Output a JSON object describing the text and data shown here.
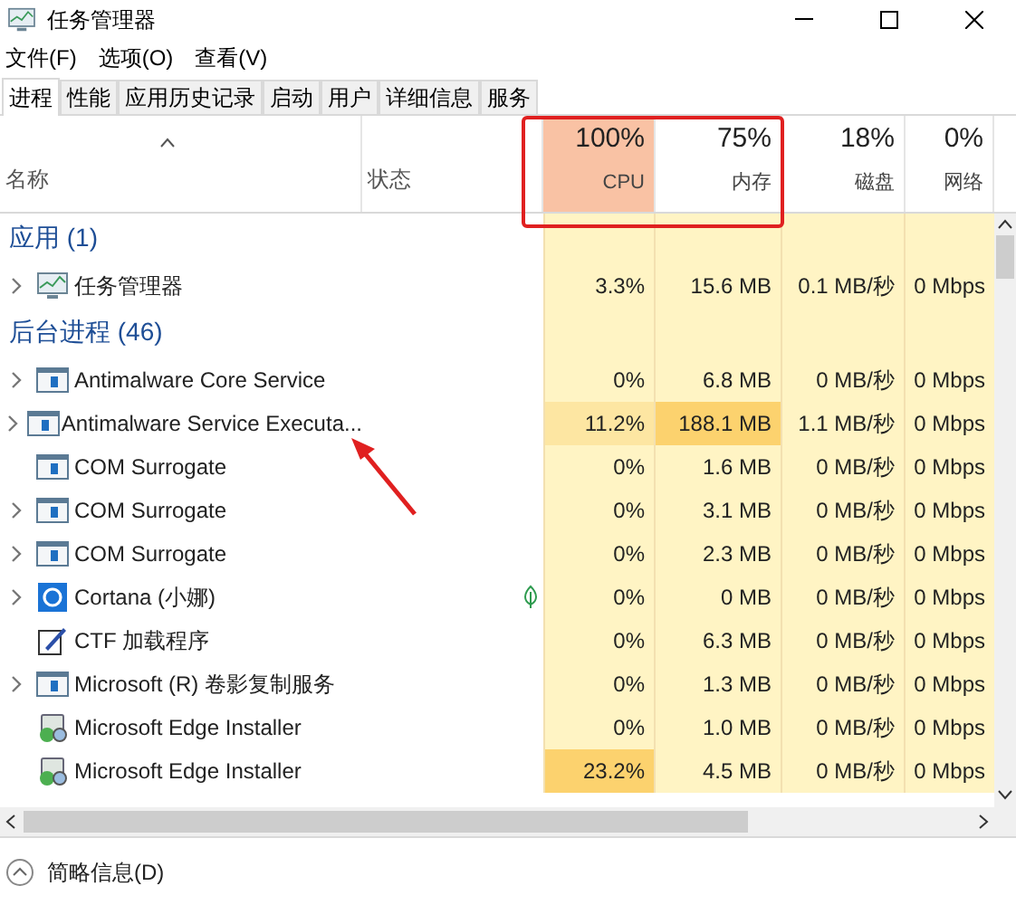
{
  "window": {
    "title": "任务管理器"
  },
  "menu": [
    "文件(F)",
    "选项(O)",
    "查看(V)"
  ],
  "tabs": [
    {
      "label": "进程",
      "selected": true
    },
    {
      "label": "性能",
      "selected": false
    },
    {
      "label": "应用历史记录",
      "selected": false
    },
    {
      "label": "启动",
      "selected": false
    },
    {
      "label": "用户",
      "selected": false
    },
    {
      "label": "详细信息",
      "selected": false
    },
    {
      "label": "服务",
      "selected": false
    }
  ],
  "columns": [
    {
      "kind": "name",
      "label": "名称"
    },
    {
      "kind": "status",
      "label": "状态"
    },
    {
      "kind": "metric",
      "value": "100%",
      "label": "CPU",
      "color": "#f9c2a4"
    },
    {
      "kind": "metric",
      "value": "75%",
      "label": "内存",
      "color": "#ffffff"
    },
    {
      "kind": "metric",
      "value": "18%",
      "label": "磁盘",
      "color": "#ffffff"
    },
    {
      "kind": "metric",
      "value": "0%",
      "label": "网络",
      "color": "#ffffff"
    }
  ],
  "rows": [
    {
      "kind": "group",
      "label": "应用 (1)"
    },
    {
      "kind": "taskmgr",
      "expandable": true,
      "suspended": false,
      "name": "任务管理器",
      "cells": [
        {
          "text": "3.3%"
        },
        {
          "text": "15.6 MB"
        },
        {
          "text": "0.1 MB/秒"
        },
        {
          "text": "0 Mbps"
        }
      ]
    },
    {
      "kind": "group",
      "label": "后台进程 (46)"
    },
    {
      "kind": "service",
      "expandable": true,
      "suspended": false,
      "name": "Antimalware Core Service",
      "cells": [
        {
          "text": "0%"
        },
        {
          "text": "6.8 MB"
        },
        {
          "text": "0 MB/秒"
        },
        {
          "text": "0 Mbps"
        }
      ]
    },
    {
      "kind": "service",
      "expandable": true,
      "suspended": false,
      "name": "Antimalware Service Executa...",
      "cells": [
        {
          "text": "11.2%",
          "color": "#fde6a2"
        },
        {
          "text": "188.1 MB",
          "color": "#fcd26e"
        },
        {
          "text": "1.1 MB/秒"
        },
        {
          "text": "0 Mbps"
        }
      ]
    },
    {
      "kind": "service",
      "expandable": false,
      "suspended": false,
      "name": "COM Surrogate",
      "cells": [
        {
          "text": "0%"
        },
        {
          "text": "1.6 MB"
        },
        {
          "text": "0 MB/秒"
        },
        {
          "text": "0 Mbps"
        }
      ]
    },
    {
      "kind": "service",
      "expandable": true,
      "suspended": false,
      "name": "COM Surrogate",
      "cells": [
        {
          "text": "0%"
        },
        {
          "text": "3.1 MB"
        },
        {
          "text": "0 MB/秒"
        },
        {
          "text": "0 Mbps"
        }
      ]
    },
    {
      "kind": "service",
      "expandable": true,
      "suspended": false,
      "name": "COM Surrogate",
      "cells": [
        {
          "text": "0%"
        },
        {
          "text": "2.3 MB"
        },
        {
          "text": "0 MB/秒"
        },
        {
          "text": "0 Mbps"
        }
      ]
    },
    {
      "kind": "cortana",
      "expandable": true,
      "suspended": true,
      "name": "Cortana (小娜)",
      "cells": [
        {
          "text": "0%"
        },
        {
          "text": "0 MB"
        },
        {
          "text": "0 MB/秒"
        },
        {
          "text": "0 Mbps"
        }
      ]
    },
    {
      "kind": "ctf",
      "expandable": false,
      "suspended": false,
      "name": "CTF 加载程序",
      "cells": [
        {
          "text": "0%"
        },
        {
          "text": "6.3 MB"
        },
        {
          "text": "0 MB/秒"
        },
        {
          "text": "0 Mbps"
        }
      ]
    },
    {
      "kind": "service",
      "expandable": true,
      "suspended": false,
      "name": "Microsoft (R) 卷影复制服务",
      "cells": [
        {
          "text": "0%"
        },
        {
          "text": "1.3 MB"
        },
        {
          "text": "0 MB/秒"
        },
        {
          "text": "0 Mbps"
        }
      ]
    },
    {
      "kind": "installer",
      "expandable": false,
      "suspended": false,
      "name": "Microsoft Edge Installer",
      "cells": [
        {
          "text": "0%"
        },
        {
          "text": "1.0 MB"
        },
        {
          "text": "0 MB/秒"
        },
        {
          "text": "0 Mbps"
        }
      ]
    },
    {
      "kind": "installer",
      "expandable": false,
      "suspended": false,
      "name": "Microsoft Edge Installer",
      "cells": [
        {
          "text": "23.2%",
          "color": "#fcd26e"
        },
        {
          "text": "4.5 MB"
        },
        {
          "text": "0 MB/秒"
        },
        {
          "text": "0 Mbps"
        }
      ]
    }
  ],
  "footer": {
    "label": "简略信息(D)"
  }
}
